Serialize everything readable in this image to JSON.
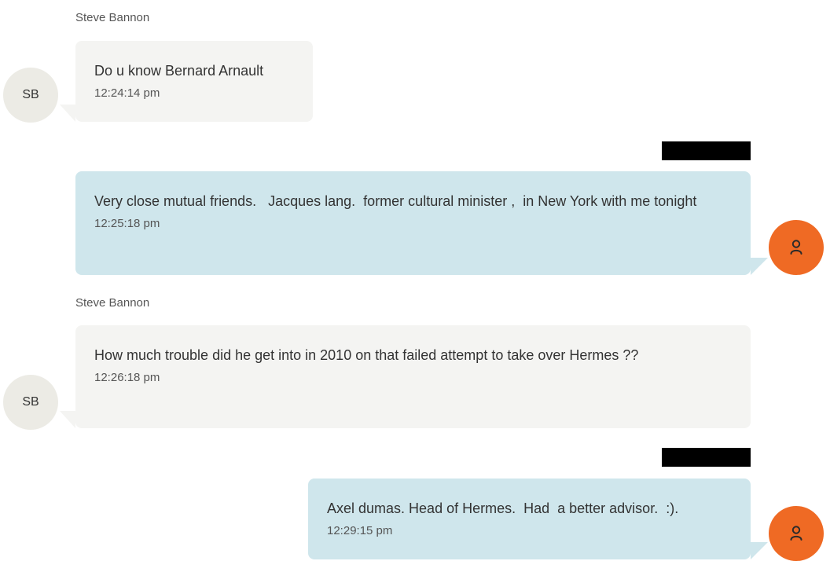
{
  "messages": [
    {
      "direction": "incoming",
      "sender": "Steve Bannon",
      "initials": "SB",
      "text": "Do u know Bernard Arnault",
      "time": "12:24:14 pm"
    },
    {
      "direction": "outgoing",
      "sender_redacted": true,
      "avatar_icon": "user-icon",
      "text": "Very close mutual friends.   Jacques lang.  former cultural minister ,  in New York with me tonight",
      "time": "12:25:18 pm"
    },
    {
      "direction": "incoming",
      "sender": "Steve Bannon",
      "initials": "SB",
      "text": "How much trouble did he get into in 2010 on that failed attempt to take over Hermes ??",
      "time": "12:26:18 pm"
    },
    {
      "direction": "outgoing",
      "sender_redacted": true,
      "avatar_icon": "user-icon",
      "text": "Axel dumas. Head of Hermes.  Had  a better advisor.  :).",
      "time": "12:29:15 pm"
    }
  ],
  "colors": {
    "incoming_bubble": "#f4f4f2",
    "outgoing_bubble": "#cfe6ec",
    "incoming_avatar": "#ecebe5",
    "outgoing_avatar": "#ef6a24",
    "redaction": "#000000"
  }
}
